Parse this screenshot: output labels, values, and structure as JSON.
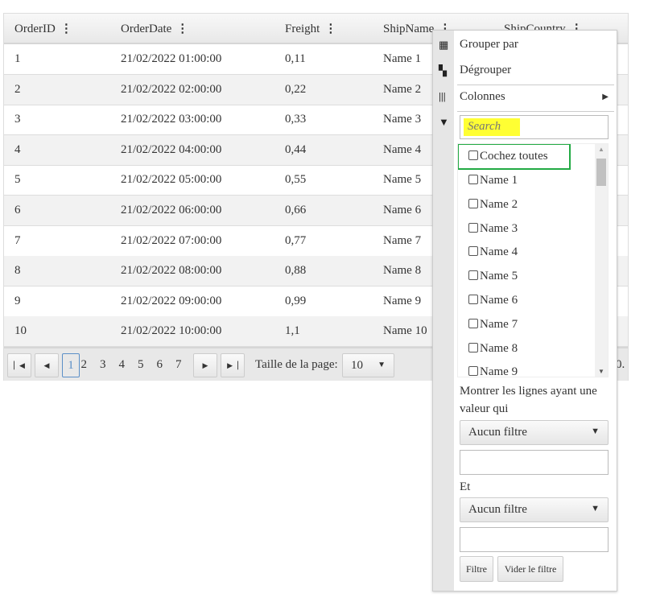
{
  "columns": [
    "OrderID",
    "OrderDate",
    "Freight",
    "ShipName",
    "ShipCountry"
  ],
  "rows": [
    [
      "1",
      "21/02/2022 01:00:00",
      "0,11",
      "Name 1"
    ],
    [
      "2",
      "21/02/2022 02:00:00",
      "0,22",
      "Name 2"
    ],
    [
      "3",
      "21/02/2022 03:00:00",
      "0,33",
      "Name 3"
    ],
    [
      "4",
      "21/02/2022 04:00:00",
      "0,44",
      "Name 4"
    ],
    [
      "5",
      "21/02/2022 05:00:00",
      "0,55",
      "Name 5"
    ],
    [
      "6",
      "21/02/2022 06:00:00",
      "0,66",
      "Name 6"
    ],
    [
      "7",
      "21/02/2022 07:00:00",
      "0,77",
      "Name 7"
    ],
    [
      "8",
      "21/02/2022 08:00:00",
      "0,88",
      "Name 8"
    ],
    [
      "9",
      "21/02/2022 09:00:00",
      "0,99",
      "Name 9"
    ],
    [
      "10",
      "21/02/2022 10:00:00",
      "1,1",
      "Name 10"
    ]
  ],
  "pager": {
    "pages": [
      "1",
      "2",
      "3",
      "4",
      "5",
      "6",
      "7"
    ],
    "current": "1",
    "page_size_label": "Taille de la page:",
    "page_size": "10",
    "info_fragment": "0."
  },
  "menu": {
    "group_by": "Grouper par",
    "ungroup": "Dégrouper",
    "columns": "Colonnes",
    "search_placeholder": "Search",
    "check_all": "Cochez toutes",
    "items": [
      "Name 1",
      "Name 2",
      "Name 3",
      "Name 4",
      "Name 5",
      "Name 6",
      "Name 7",
      "Name 8",
      "Name 9"
    ],
    "filter_text": "Montrer les lignes ayant une",
    "filter_text2": "valeur qui",
    "operator1": "Aucun filtre",
    "and": "Et",
    "operator2": "Aucun filtre",
    "filter_button": "Filtre",
    "clear_button": "Vider le filtre"
  },
  "colors": {
    "search_highlight": "#ffff33",
    "check_all_border": "#22aa44",
    "current_page": "#5b8fc7"
  }
}
